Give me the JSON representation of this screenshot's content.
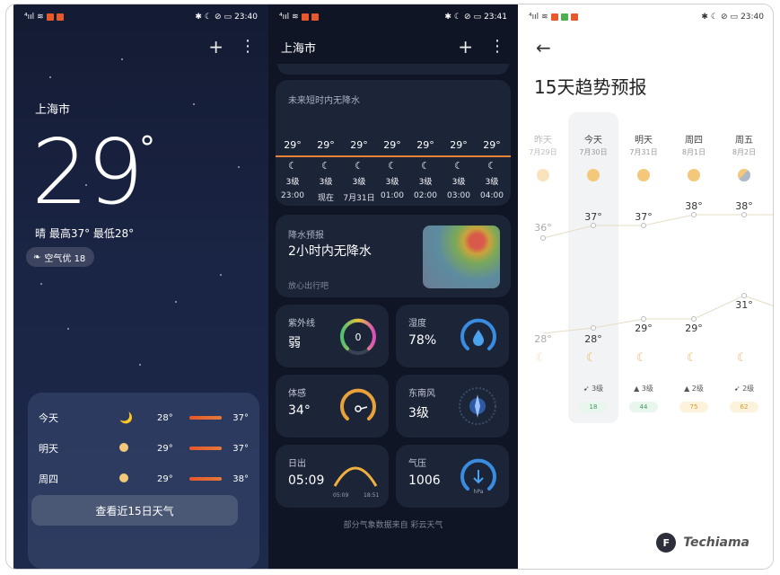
{
  "status": {
    "left_time": "23:40",
    "mid_time": "23:41",
    "right_time": "23:40"
  },
  "p1": {
    "city": "上海市",
    "temp": "29",
    "deg": "°",
    "condition": "晴  最高37°  最低28°",
    "air": "空气优 18",
    "forecast": [
      {
        "day": "今天",
        "lo": "28°",
        "hi": "37°"
      },
      {
        "day": "明天",
        "lo": "29°",
        "hi": "37°"
      },
      {
        "day": "周四",
        "lo": "29°",
        "hi": "38°"
      }
    ],
    "button": "查看近15日天气"
  },
  "p2": {
    "city": "上海市",
    "hourly_title": "未来短时内无降水",
    "hours": [
      {
        "t": "29°",
        "lv": "3级",
        "hr": "23:00"
      },
      {
        "t": "29°",
        "lv": "3级",
        "hr": "现在"
      },
      {
        "t": "29°",
        "lv": "3级",
        "hr": "7月31日"
      },
      {
        "t": "29°",
        "lv": "3级",
        "hr": "01:00"
      },
      {
        "t": "29°",
        "lv": "3级",
        "hr": "02:00"
      },
      {
        "t": "29°",
        "lv": "3级",
        "hr": "03:00"
      },
      {
        "t": "29°",
        "lv": "3级",
        "hr": "04:00"
      }
    ],
    "rain_label": "降水预报",
    "rain_main": "2小时内无降水",
    "rain_sub": "放心出行吧",
    "tiles": [
      {
        "label": "紫外线",
        "value": "弱",
        "gauge": "0"
      },
      {
        "label": "湿度",
        "value": "78%"
      },
      {
        "label": "体感",
        "value": "34°"
      },
      {
        "label": "东南风",
        "value": "3级"
      },
      {
        "label": "日出",
        "value": "05:09",
        "a": "05:09",
        "b": "18:51"
      },
      {
        "label": "气压",
        "value": "1006",
        "unit": "hPa"
      }
    ],
    "note": "部分气象数据来自  彩云天气"
  },
  "p3": {
    "title": "15天趋势预报",
    "days": [
      {
        "name": "昨天",
        "date": "7月29日",
        "hi": "36°",
        "lo": "28°",
        "wind": "",
        "aqi": ""
      },
      {
        "name": "今天",
        "date": "7月30日",
        "hi": "37°",
        "lo": "28°",
        "wind": "3级",
        "aqi": "18"
      },
      {
        "name": "明天",
        "date": "7月31日",
        "hi": "37°",
        "lo": "29°",
        "wind": "3级",
        "aqi": "44"
      },
      {
        "name": "周四",
        "date": "8月1日",
        "hi": "38°",
        "lo": "29°",
        "wind": "2级",
        "aqi": "75"
      },
      {
        "name": "周五",
        "date": "8月2日",
        "hi": "38°",
        "lo": "31°",
        "wind": "2级",
        "aqi": "62"
      }
    ],
    "watermark": "Techiama"
  }
}
